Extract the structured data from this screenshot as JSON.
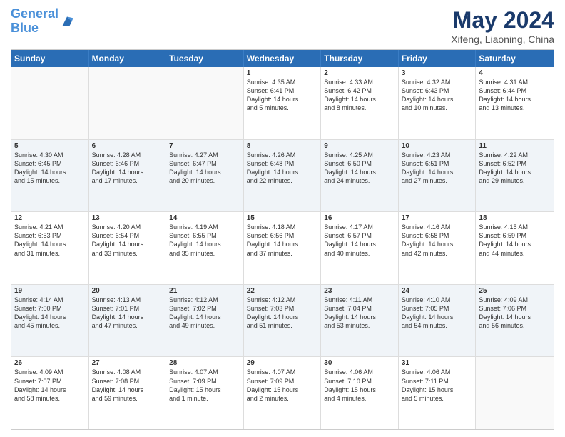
{
  "header": {
    "logo_line1": "General",
    "logo_line2": "Blue",
    "title": "May 2024",
    "subtitle": "Xifeng, Liaoning, China"
  },
  "days_of_week": [
    "Sunday",
    "Monday",
    "Tuesday",
    "Wednesday",
    "Thursday",
    "Friday",
    "Saturday"
  ],
  "weeks": [
    [
      {
        "day": "",
        "info": ""
      },
      {
        "day": "",
        "info": ""
      },
      {
        "day": "",
        "info": ""
      },
      {
        "day": "1",
        "info": "Sunrise: 4:35 AM\nSunset: 6:41 PM\nDaylight: 14 hours\nand 5 minutes."
      },
      {
        "day": "2",
        "info": "Sunrise: 4:33 AM\nSunset: 6:42 PM\nDaylight: 14 hours\nand 8 minutes."
      },
      {
        "day": "3",
        "info": "Sunrise: 4:32 AM\nSunset: 6:43 PM\nDaylight: 14 hours\nand 10 minutes."
      },
      {
        "day": "4",
        "info": "Sunrise: 4:31 AM\nSunset: 6:44 PM\nDaylight: 14 hours\nand 13 minutes."
      }
    ],
    [
      {
        "day": "5",
        "info": "Sunrise: 4:30 AM\nSunset: 6:45 PM\nDaylight: 14 hours\nand 15 minutes."
      },
      {
        "day": "6",
        "info": "Sunrise: 4:28 AM\nSunset: 6:46 PM\nDaylight: 14 hours\nand 17 minutes."
      },
      {
        "day": "7",
        "info": "Sunrise: 4:27 AM\nSunset: 6:47 PM\nDaylight: 14 hours\nand 20 minutes."
      },
      {
        "day": "8",
        "info": "Sunrise: 4:26 AM\nSunset: 6:48 PM\nDaylight: 14 hours\nand 22 minutes."
      },
      {
        "day": "9",
        "info": "Sunrise: 4:25 AM\nSunset: 6:50 PM\nDaylight: 14 hours\nand 24 minutes."
      },
      {
        "day": "10",
        "info": "Sunrise: 4:23 AM\nSunset: 6:51 PM\nDaylight: 14 hours\nand 27 minutes."
      },
      {
        "day": "11",
        "info": "Sunrise: 4:22 AM\nSunset: 6:52 PM\nDaylight: 14 hours\nand 29 minutes."
      }
    ],
    [
      {
        "day": "12",
        "info": "Sunrise: 4:21 AM\nSunset: 6:53 PM\nDaylight: 14 hours\nand 31 minutes."
      },
      {
        "day": "13",
        "info": "Sunrise: 4:20 AM\nSunset: 6:54 PM\nDaylight: 14 hours\nand 33 minutes."
      },
      {
        "day": "14",
        "info": "Sunrise: 4:19 AM\nSunset: 6:55 PM\nDaylight: 14 hours\nand 35 minutes."
      },
      {
        "day": "15",
        "info": "Sunrise: 4:18 AM\nSunset: 6:56 PM\nDaylight: 14 hours\nand 37 minutes."
      },
      {
        "day": "16",
        "info": "Sunrise: 4:17 AM\nSunset: 6:57 PM\nDaylight: 14 hours\nand 40 minutes."
      },
      {
        "day": "17",
        "info": "Sunrise: 4:16 AM\nSunset: 6:58 PM\nDaylight: 14 hours\nand 42 minutes."
      },
      {
        "day": "18",
        "info": "Sunrise: 4:15 AM\nSunset: 6:59 PM\nDaylight: 14 hours\nand 44 minutes."
      }
    ],
    [
      {
        "day": "19",
        "info": "Sunrise: 4:14 AM\nSunset: 7:00 PM\nDaylight: 14 hours\nand 45 minutes."
      },
      {
        "day": "20",
        "info": "Sunrise: 4:13 AM\nSunset: 7:01 PM\nDaylight: 14 hours\nand 47 minutes."
      },
      {
        "day": "21",
        "info": "Sunrise: 4:12 AM\nSunset: 7:02 PM\nDaylight: 14 hours\nand 49 minutes."
      },
      {
        "day": "22",
        "info": "Sunrise: 4:12 AM\nSunset: 7:03 PM\nDaylight: 14 hours\nand 51 minutes."
      },
      {
        "day": "23",
        "info": "Sunrise: 4:11 AM\nSunset: 7:04 PM\nDaylight: 14 hours\nand 53 minutes."
      },
      {
        "day": "24",
        "info": "Sunrise: 4:10 AM\nSunset: 7:05 PM\nDaylight: 14 hours\nand 54 minutes."
      },
      {
        "day": "25",
        "info": "Sunrise: 4:09 AM\nSunset: 7:06 PM\nDaylight: 14 hours\nand 56 minutes."
      }
    ],
    [
      {
        "day": "26",
        "info": "Sunrise: 4:09 AM\nSunset: 7:07 PM\nDaylight: 14 hours\nand 58 minutes."
      },
      {
        "day": "27",
        "info": "Sunrise: 4:08 AM\nSunset: 7:08 PM\nDaylight: 14 hours\nand 59 minutes."
      },
      {
        "day": "28",
        "info": "Sunrise: 4:07 AM\nSunset: 7:09 PM\nDaylight: 15 hours\nand 1 minute."
      },
      {
        "day": "29",
        "info": "Sunrise: 4:07 AM\nSunset: 7:09 PM\nDaylight: 15 hours\nand 2 minutes."
      },
      {
        "day": "30",
        "info": "Sunrise: 4:06 AM\nSunset: 7:10 PM\nDaylight: 15 hours\nand 4 minutes."
      },
      {
        "day": "31",
        "info": "Sunrise: 4:06 AM\nSunset: 7:11 PM\nDaylight: 15 hours\nand 5 minutes."
      },
      {
        "day": "",
        "info": ""
      }
    ]
  ]
}
